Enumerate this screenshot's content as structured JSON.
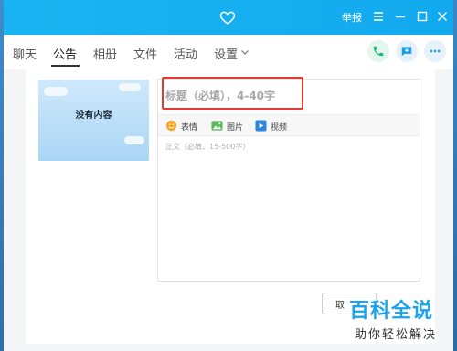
{
  "titlebar": {
    "report_label": "举报",
    "heart_icon": "heart-icon",
    "controls": [
      "menu-icon",
      "minimize-icon",
      "maximize-icon",
      "close-icon"
    ],
    "color": "#14aef0"
  },
  "nav": {
    "tabs": [
      {
        "label": "聊天",
        "active": false
      },
      {
        "label": "公告",
        "active": true
      },
      {
        "label": "相册",
        "active": false
      },
      {
        "label": "文件",
        "active": false
      },
      {
        "label": "活动",
        "active": false
      },
      {
        "label": "设置",
        "active": false
      }
    ],
    "actions": [
      "phone-icon",
      "message-add-icon",
      "more-icon"
    ]
  },
  "cover": {
    "text": "没有内容"
  },
  "editor": {
    "title_placeholder": "标题（必填），4-40字",
    "toolbar": [
      {
        "label": "表情",
        "icon": "emoji-icon",
        "color": "#f5a623"
      },
      {
        "label": "图片",
        "icon": "image-icon",
        "color": "#5cb85c"
      },
      {
        "label": "视频",
        "icon": "video-icon",
        "color": "#2e86de"
      }
    ],
    "body_placeholder": "正文（必填，15-500字）"
  },
  "footer": {
    "cancel_label": "取"
  },
  "watermark": {
    "title": "百科全说",
    "subtitle": "助你轻松解决"
  }
}
